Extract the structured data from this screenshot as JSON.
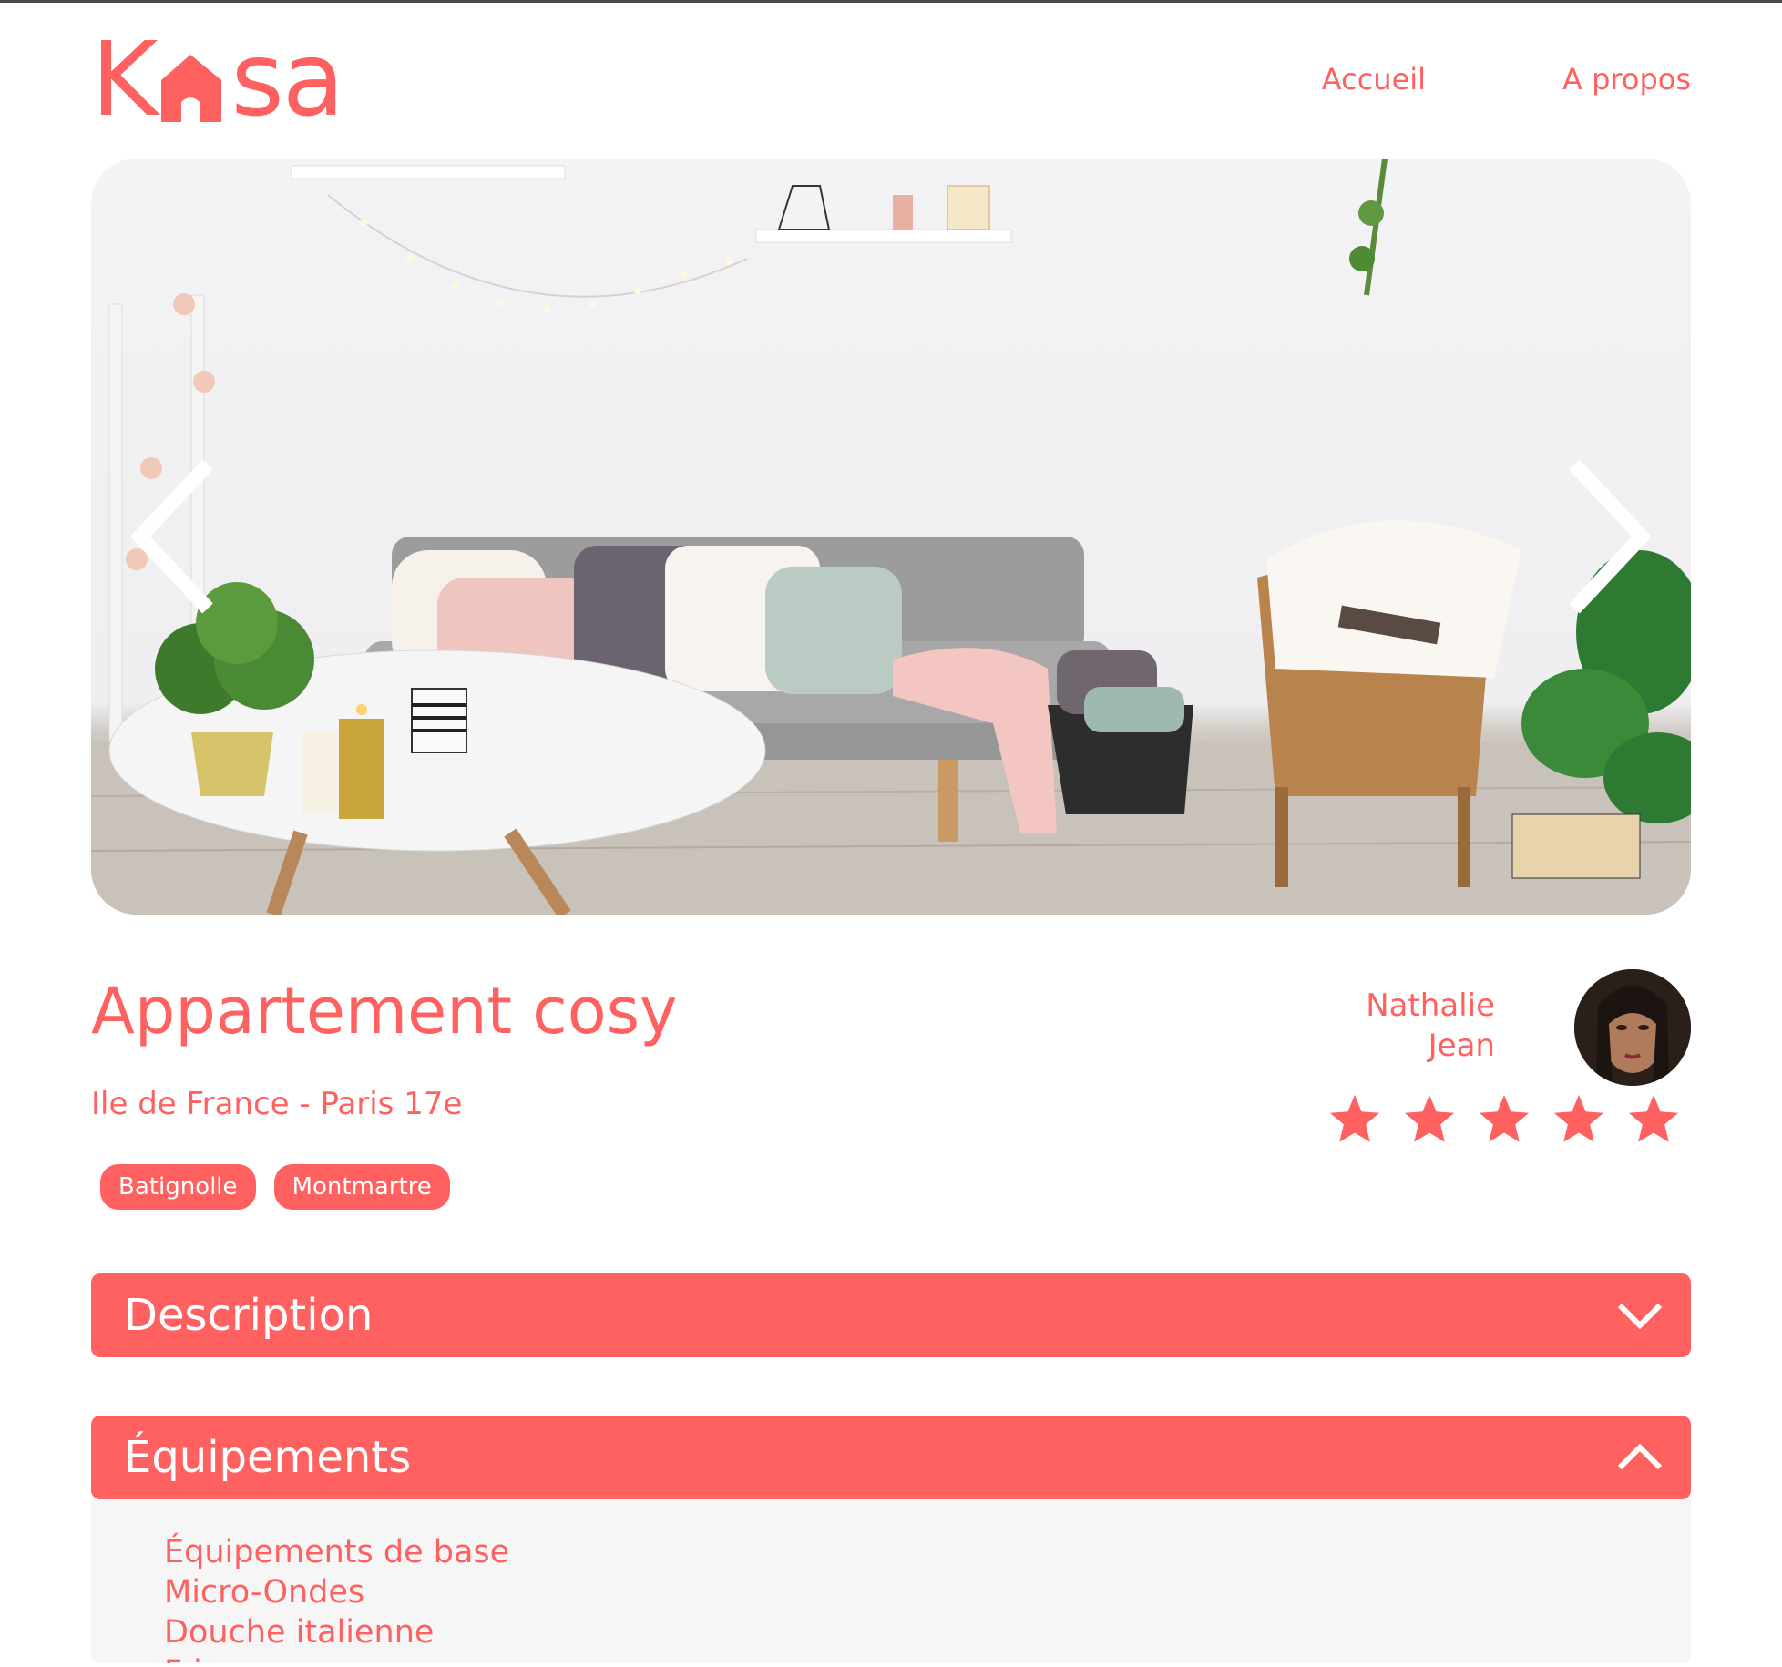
{
  "brand": {
    "logo_prefix": "K",
    "logo_suffix": "sa",
    "color": "#FF6060"
  },
  "nav": {
    "home": "Accueil",
    "about": "A propos"
  },
  "listing": {
    "title": "Appartement cosy",
    "location": "Ile de France - Paris 17e",
    "tags": [
      "Batignolle",
      "Montmartre"
    ],
    "host": {
      "first_name": "Nathalie",
      "last_name": "Jean"
    },
    "rating": 5,
    "rating_max": 5
  },
  "sections": {
    "description": {
      "title": "Description",
      "state": "collapsed",
      "icon": "chevron-down-icon"
    },
    "equipment": {
      "title": "Équipements",
      "state": "expanded",
      "icon": "chevron-up-icon",
      "items": [
        "Équipements de base",
        "Micro-Ondes",
        "Douche italienne",
        "Frigo"
      ]
    }
  },
  "carousel": {
    "prev_icon": "chevron-left-icon",
    "next_icon": "chevron-right-icon"
  }
}
